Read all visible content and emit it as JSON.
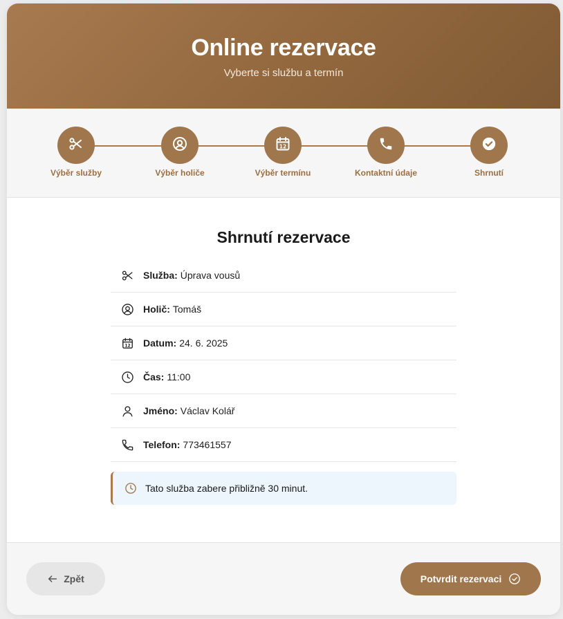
{
  "header": {
    "title": "Online rezervace",
    "subtitle": "Vyberte si službu a termín"
  },
  "steps": [
    {
      "label": "Výběr služby",
      "icon": "scissors-icon"
    },
    {
      "label": "Výběr holiče",
      "icon": "user-circle-icon"
    },
    {
      "label": "Výběr termínu",
      "icon": "calendar-icon",
      "calendar_day": "12"
    },
    {
      "label": "Kontaktní údaje",
      "icon": "phone-icon"
    },
    {
      "label": "Shrnutí",
      "icon": "check-circle-icon"
    }
  ],
  "summary": {
    "title": "Shrnutí rezervace",
    "rows": [
      {
        "label": "Služba:",
        "value": "Úprava vousů",
        "icon": "scissors-icon"
      },
      {
        "label": "Holič:",
        "value": "Tomáš",
        "icon": "user-circle-icon"
      },
      {
        "label": "Datum:",
        "value": "24. 6. 2025",
        "icon": "calendar-icon"
      },
      {
        "label": "Čas:",
        "value": "11:00",
        "icon": "clock-icon"
      },
      {
        "label": "Jméno:",
        "value": "Václav Kolář",
        "icon": "user-icon"
      },
      {
        "label": "Telefon:",
        "value": "773461557",
        "icon": "phone-icon"
      }
    ],
    "note": "Tato služba zabere přibližně 30 minut."
  },
  "footer": {
    "back_label": "Zpět",
    "confirm_label": "Potvrdit rezervaci"
  },
  "colors": {
    "accent": "#a0764c",
    "header_gradient_start": "#a87a4f",
    "header_gradient_end": "#7f5a34",
    "note_background": "#edf5fd"
  }
}
